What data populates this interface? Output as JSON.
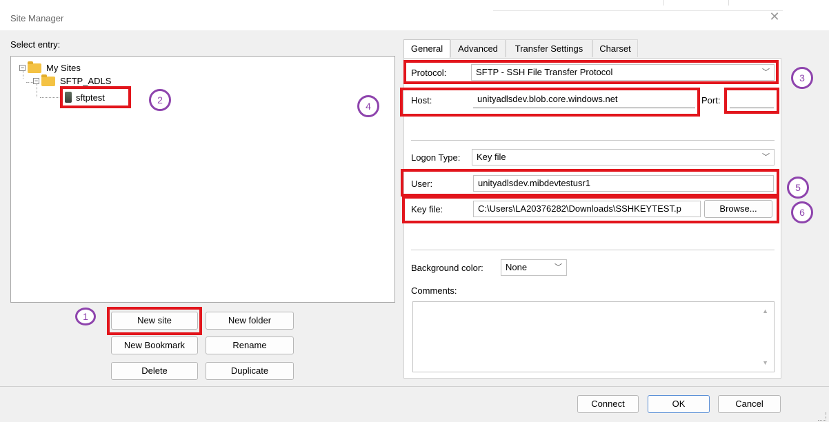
{
  "window": {
    "title": "Site Manager"
  },
  "tree": {
    "label": "Select entry:",
    "root": {
      "label": "My Sites",
      "toggle": "−"
    },
    "folder": {
      "label": "SFTP_ADLS",
      "toggle": "−"
    },
    "site": {
      "label": "sftptest"
    }
  },
  "buttons": {
    "new_site": "New site",
    "new_folder": "New folder",
    "new_bookmark": "New Bookmark",
    "rename": "Rename",
    "delete": "Delete",
    "duplicate": "Duplicate"
  },
  "tabs": [
    "General",
    "Advanced",
    "Transfer Settings",
    "Charset"
  ],
  "general": {
    "protocol": {
      "label": "Protocol:",
      "value": "SFTP - SSH File Transfer Protocol"
    },
    "host": {
      "label": "Host:",
      "value": "unityadlsdev.blob.core.windows.net"
    },
    "port": {
      "label": "Port:",
      "value": ""
    },
    "logon_type": {
      "label": "Logon Type:",
      "value": "Key file"
    },
    "user": {
      "label": "User:",
      "value": "unityadlsdev.mibdevtestusr1"
    },
    "key_file": {
      "label": "Key file:",
      "value": "C:\\Users\\LA20376282\\Downloads\\SSHKEYTEST.p",
      "browse": "Browse..."
    },
    "background_color": {
      "label": "Background color:",
      "value": "None"
    },
    "comments": {
      "label": "Comments:",
      "value": ""
    }
  },
  "footer": {
    "connect": "Connect",
    "ok": "OK",
    "cancel": "Cancel"
  },
  "annotations": [
    "1",
    "2",
    "3",
    "4",
    "5",
    "6"
  ],
  "icons": {
    "close": "close-icon",
    "chevron": "chevron-down-icon",
    "folder": "folder-icon",
    "server": "server-icon",
    "scroll_up": "scroll-up-icon",
    "scroll_down": "scroll-down-icon"
  },
  "colors": {
    "highlight_box": "#e2151c",
    "annotation_circle": "#8e44ad"
  }
}
